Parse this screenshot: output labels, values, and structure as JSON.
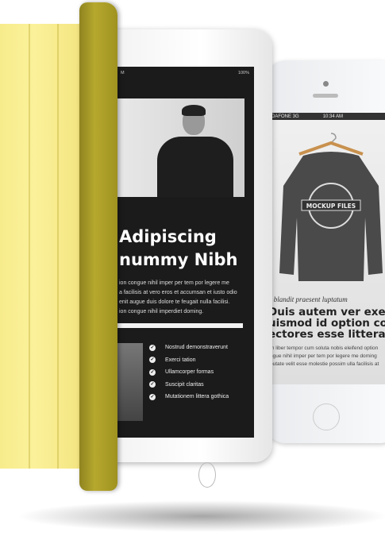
{
  "ipad": {
    "status_time": "M",
    "status_battery": "100%",
    "headline_line1": "Adipiscing",
    "headline_line2": "nummy Nibh",
    "body_lines": [
      "ion congue nihil imper per tem por legere me",
      "a facilisis at vero eros et accumsan et iusto odio",
      "enit augue duis dolore te feugait nulla facilisi.",
      "ion congue nihil imperdiet doming."
    ],
    "checklist": [
      "Nostrud demonstraverunt",
      "Exerci tation",
      "Ullamcorper  formas",
      "Suscipit claritas",
      "Mutationem littera gothica"
    ]
  },
  "phone": {
    "carrier": "DAFONE  3G",
    "time": "10:34 AM",
    "sweater_logo": "MOCKUP FILES",
    "kicker": "i blandit praesent luptatum",
    "headline_lines": [
      "Duis autem ver exerci.",
      "uismod id option cong",
      "ectores esse littera."
    ],
    "body_lines": [
      "m liber tempor cum soluta nobis eleifend option",
      "ngue nihil imper per tem por legere me doming",
      "putate velit esse molestie possim ulla facilisis at"
    ]
  },
  "colors": {
    "cover": "#f7ec8c",
    "spine": "#a89a25",
    "screen": "#1b1b1b"
  }
}
